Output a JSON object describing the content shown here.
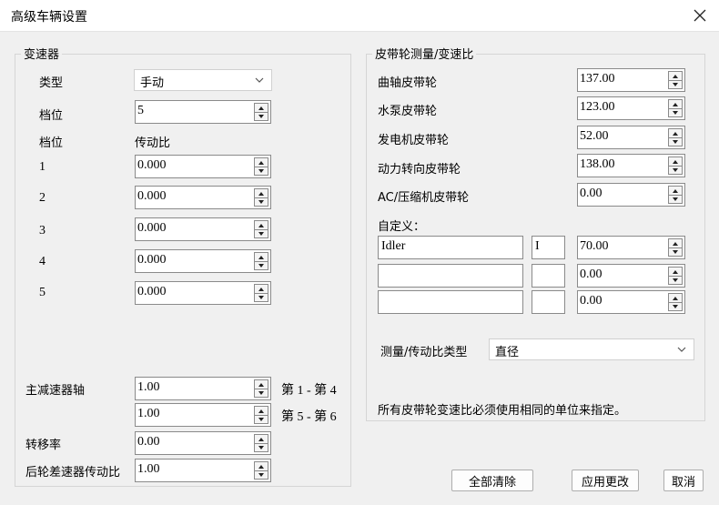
{
  "window": {
    "title": "高级车辆设置"
  },
  "transmission": {
    "legend": "变速器",
    "type_label": "类型",
    "type_value": "手动",
    "gears_label": "档位",
    "gears_value": "5",
    "col_gear": "档位",
    "col_ratio": "传动比",
    "gears": [
      {
        "num": "1",
        "ratio": "0.000"
      },
      {
        "num": "2",
        "ratio": "0.000"
      },
      {
        "num": "3",
        "ratio": "0.000"
      },
      {
        "num": "4",
        "ratio": "0.000"
      },
      {
        "num": "5",
        "ratio": "0.000"
      }
    ],
    "main_reducer_label": "主减速器轴",
    "main_reducer_1": "1.00",
    "main_reducer_1_range": "第 1 - 第 4",
    "main_reducer_2": "1.00",
    "main_reducer_2_range": "第 5 - 第 6",
    "transfer_label": "转移率",
    "transfer_value": "0.00",
    "rear_diff_label": "后轮差速器传动比",
    "rear_diff_value": "1.00"
  },
  "pulley": {
    "legend": "皮带轮测量/变速比",
    "rows": [
      {
        "label": "曲轴皮带轮",
        "value": "137.00"
      },
      {
        "label": "水泵皮带轮",
        "value": "123.00"
      },
      {
        "label": "发电机皮带轮",
        "value": "52.00"
      },
      {
        "label": "动力转向皮带轮",
        "value": "138.00"
      },
      {
        "label": "AC/压缩机皮带轮",
        "value": "0.00"
      }
    ],
    "custom_label": "自定义：",
    "custom": [
      {
        "name": "Idler",
        "code": "I",
        "value": "70.00"
      },
      {
        "name": "",
        "code": "",
        "value": "0.00"
      },
      {
        "name": "",
        "code": "",
        "value": "0.00"
      }
    ],
    "measure_type_label": "测量/传动比类型",
    "measure_type_value": "直径",
    "note": "所有皮带轮变速比必须使用相同的单位来指定。"
  },
  "buttons": {
    "clear_all": "全部清除",
    "apply": "应用更改",
    "cancel": "取消"
  }
}
